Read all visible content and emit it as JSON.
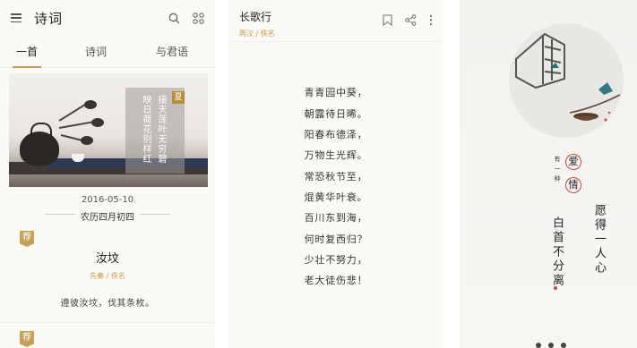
{
  "panel1": {
    "app_title": "诗词",
    "tabs": [
      "一首",
      "诗词",
      "与君语"
    ],
    "hero": {
      "season": "夏",
      "line1": "接天莲叶无穷碧",
      "line2": "映日荷花别样红"
    },
    "date": "2016-05-10",
    "lunar": "农历四月初四",
    "tag": "荐",
    "poem_title": "汝坟",
    "author": "先秦 / 佚名",
    "excerpt": "遵彼汝坟，伐其条枚。",
    "tag2": "荐"
  },
  "panel2": {
    "title": "长歌行",
    "subtitle": "两汉 / 佚名",
    "verses": [
      "青青园中葵，",
      "朝露待日晞。",
      "阳春布德泽，",
      "万物生光辉。",
      "常恐秋节至，",
      "焜黄华叶衰。",
      "百川东到海，",
      "何时复西归？",
      "少壮不努力，",
      "老大徒伤悲！"
    ]
  },
  "panel3": {
    "small_text": "有一种",
    "badge1": "爱",
    "badge2": "情",
    "line1": "愿得一人心",
    "line2": "白首不分离"
  },
  "colors": {
    "accent": "#c99a4a",
    "red": "#cc4444",
    "bg": "#fbfaf7"
  }
}
